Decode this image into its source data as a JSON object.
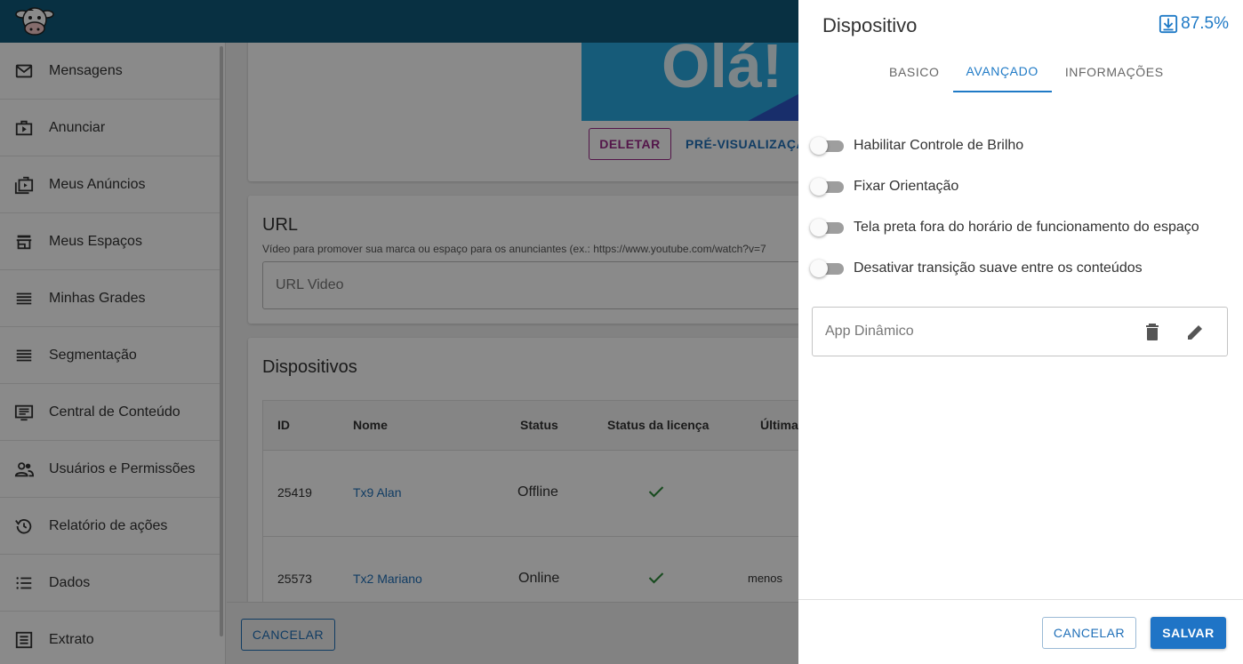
{
  "sidebar": {
    "items": [
      {
        "label": "Mensagens",
        "icon": "mail-icon"
      },
      {
        "label": "Anunciar",
        "icon": "play-briefcase-icon"
      },
      {
        "label": "Meus Anúncios",
        "icon": "ads-folder-icon"
      },
      {
        "label": "Meus Espaços",
        "icon": "storefront-icon"
      },
      {
        "label": "Minhas Grades",
        "icon": "grid-lines-icon"
      },
      {
        "label": "Segmentação",
        "icon": "segment-lines-icon"
      },
      {
        "label": "Central de Conteúdo",
        "icon": "content-list-icon"
      },
      {
        "label": "Usuários e Permissões",
        "icon": "users-icon"
      },
      {
        "label": "Relatório de ações",
        "icon": "history-icon"
      },
      {
        "label": "Dados",
        "icon": "list-icon"
      },
      {
        "label": "Extrato",
        "icon": "receipt-icon"
      }
    ]
  },
  "main": {
    "media": {
      "preview_text": "Olá!",
      "delete_label": "DELETAR",
      "preview_label": "PRÉ-VISUALIZAÇÃ"
    },
    "url_card": {
      "title": "URL",
      "description": "Vídeo para promover sua marca ou espaço para os anunciantes (ex.: https://www.youtube.com/watch?v=7",
      "placeholder": "URL Video"
    },
    "devices_card": {
      "title": "Dispositivos",
      "columns": [
        "ID",
        "Nome",
        "Status",
        "Status da licença",
        "Última"
      ],
      "rows": [
        {
          "id": "25419",
          "name": "Tx9 Alan",
          "status": "Offline",
          "license": "✓",
          "last": ""
        },
        {
          "id": "25573",
          "name": "Tx2 Mariano",
          "status": "Online",
          "license": "✓",
          "last": "menos"
        }
      ]
    },
    "cancel_label": "CANCELAR"
  },
  "panel": {
    "title": "Dispositivo",
    "progress": "87.5%",
    "tabs": [
      {
        "label": "BASICO",
        "active": false
      },
      {
        "label": "AVANÇADO",
        "active": true
      },
      {
        "label": "INFORMAÇÕES",
        "active": false
      }
    ],
    "toggles": [
      {
        "label": "Habilitar Controle de Brilho",
        "on": false
      },
      {
        "label": "Fixar Orientação",
        "on": false
      },
      {
        "label": "Tela preta fora do horário de funcionamento do espaço",
        "on": false
      },
      {
        "label": "Desativar transição suave entre os conteúdos",
        "on": false
      }
    ],
    "app_field_placeholder": "App Dinâmico",
    "cancel_label": "CANCELAR",
    "save_label": "SALVAR"
  },
  "colors": {
    "topbar": "#0f5a7a",
    "accent": "#1f7ac6",
    "delete": "#9b2a8a",
    "check": "#2e8b3a"
  }
}
